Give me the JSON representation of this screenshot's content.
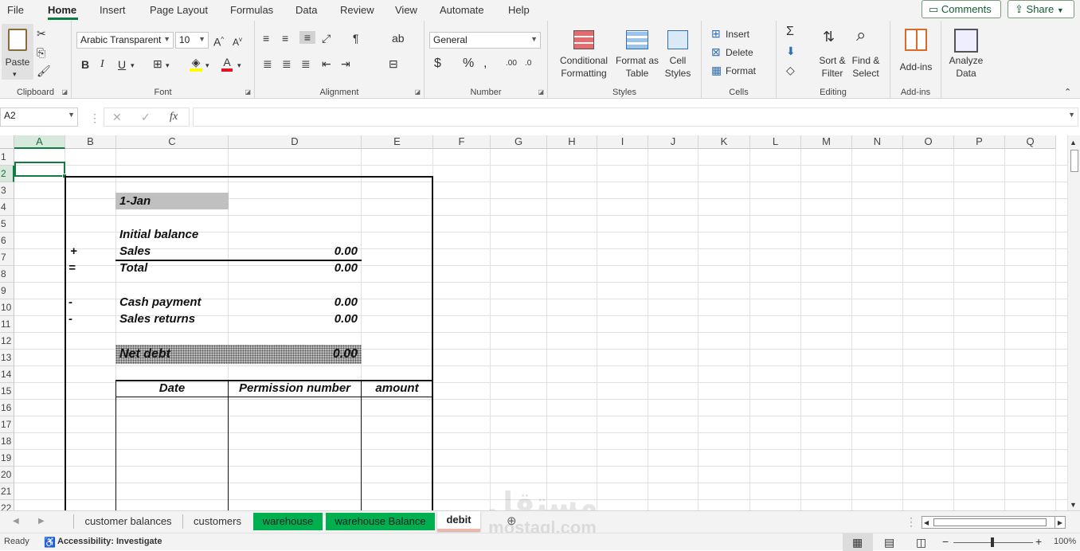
{
  "menu": {
    "tabs": [
      "File",
      "Home",
      "Insert",
      "Page Layout",
      "Formulas",
      "Data",
      "Review",
      "View",
      "Automate",
      "Help"
    ],
    "active": "Home",
    "comments_label": "Comments",
    "share_label": "Share"
  },
  "ribbon": {
    "clipboard": {
      "paste_label": "Paste",
      "group_label": "Clipboard"
    },
    "font": {
      "font_name": "Arabic Transparent",
      "font_size": "10",
      "group_label": "Font"
    },
    "alignment": {
      "group_label": "Alignment"
    },
    "number": {
      "format": "General",
      "group_label": "Number"
    },
    "styles": {
      "conditional_formatting": [
        "Conditional",
        "Formatting"
      ],
      "format_as_table": [
        "Format as",
        "Table"
      ],
      "cell_styles": [
        "Cell",
        "Styles"
      ],
      "group_label": "Styles"
    },
    "cells": {
      "insert_label": "Insert",
      "delete_label": "Delete",
      "format_label": "Format",
      "group_label": "Cells"
    },
    "editing": {
      "sort_filter": [
        "Sort &",
        "Filter"
      ],
      "find_select": [
        "Find &",
        "Select"
      ],
      "group_label": "Editing"
    },
    "addins": {
      "label": "Add-ins",
      "group_label": "Add-ins"
    },
    "analyze": {
      "label": [
        "Analyze",
        "Data"
      ]
    }
  },
  "formula_bar": {
    "name_box": "A2",
    "fx": "fx",
    "formula": ""
  },
  "grid": {
    "columns": [
      "A",
      "B",
      "C",
      "D",
      "E",
      "F",
      "G",
      "H",
      "I",
      "J",
      "K",
      "L",
      "M",
      "N",
      "O",
      "P",
      "Q"
    ],
    "rows": [
      "1",
      "2",
      "3",
      "4",
      "5",
      "6",
      "7",
      "8",
      "9",
      "10",
      "11",
      "12",
      "13",
      "14",
      "15",
      "16",
      "17",
      "18",
      "19",
      "20",
      "21",
      "22"
    ],
    "selected_cell": "A2"
  },
  "sheet": {
    "date": "1-Jan",
    "initial_balance_label": "Initial balance",
    "plus_sign": "+",
    "sales_label": "Sales",
    "sales_value": "0.00",
    "equals_sign": "=",
    "total_label": "Total",
    "total_value": "0.00",
    "minus_sign_1": "-",
    "cash_payment_label": "Cash payment",
    "cash_payment_value": "0.00",
    "minus_sign_2": "-",
    "sales_returns_label": "Sales returns",
    "sales_returns_value": "0.00",
    "net_debt_label": "Net debt",
    "net_debt_value": "0.00",
    "table_headers": [
      "Date",
      "Permission number",
      "amount"
    ]
  },
  "sheet_tabs": [
    {
      "label": "customer balances",
      "color": "#f3f3f3"
    },
    {
      "label": "customers",
      "color": "#f3f3f3"
    },
    {
      "label": "warehouse",
      "color": "#00b050"
    },
    {
      "label": "warehouse Balance",
      "color": "#00b050"
    },
    {
      "label": "debit",
      "color": "#f2b5a5"
    }
  ],
  "status": {
    "ready": "Ready",
    "accessibility": "Accessibility: Investigate",
    "zoom": "100%"
  },
  "watermark": {
    "arabic": "مستقل",
    "latin": "mostaql.com"
  }
}
